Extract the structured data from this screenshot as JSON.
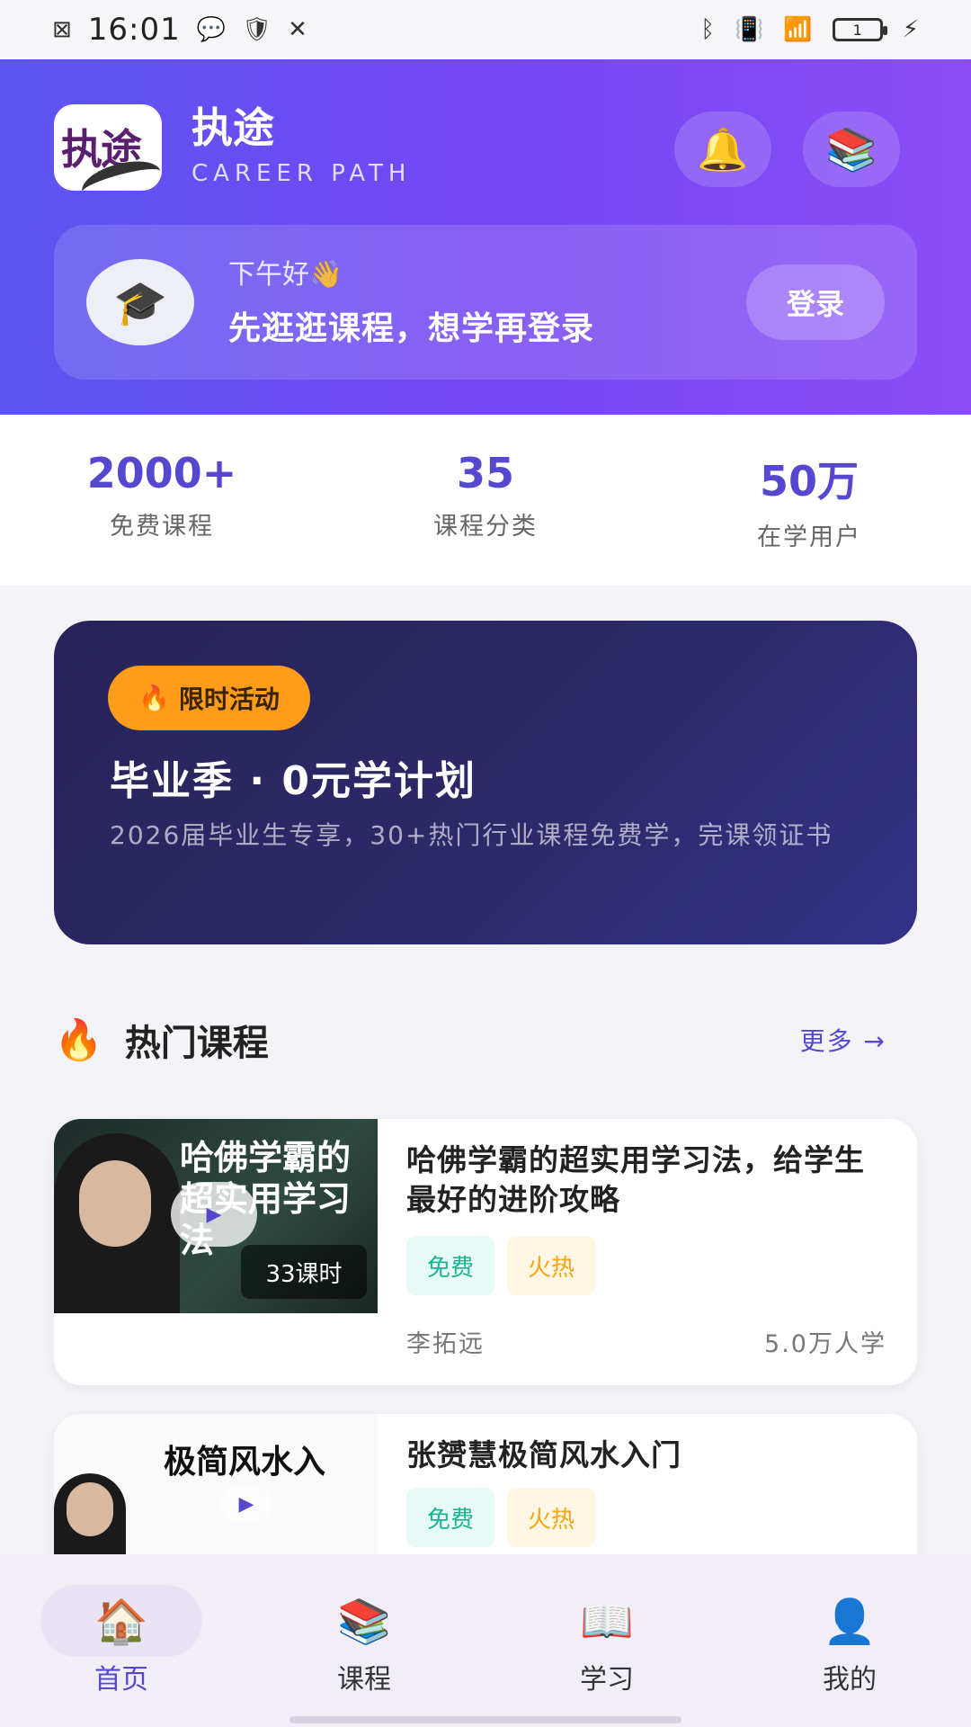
{
  "status_bar": {
    "time": "16:01",
    "battery": "1"
  },
  "header": {
    "logo_text": "执途",
    "app_name": "执途",
    "app_subtitle": "CAREER PATH",
    "bell_icon": "🔔",
    "books_icon": "📚"
  },
  "greeting": {
    "small": "下午好👋",
    "big": "先逛逛课程，想学再登录",
    "login_label": "登录",
    "avatar_icon": "🎓"
  },
  "stats": [
    {
      "value": "2000+",
      "label": "免费课程"
    },
    {
      "value": "35",
      "label": "课程分类"
    },
    {
      "value": "50万",
      "label": "在学用户"
    }
  ],
  "promo": {
    "badge": "限时活动",
    "title": "毕业季 · 0元学计划",
    "desc": "2026届毕业生专享，30+热门行业课程免费学，完课领证书"
  },
  "section": {
    "title": "热门课程",
    "more": "更多 →"
  },
  "courses": [
    {
      "thumb_text": "哈佛学霸的\n超实用学习法",
      "lessons": "33课时",
      "title": "哈佛学霸的超实用学习法，给学生最好的进阶攻略",
      "tags": [
        "免费",
        "火热"
      ],
      "teacher": "李拓远",
      "learners": "5.0万人学"
    },
    {
      "thumb_text": "极简风水入",
      "title": "张赟慧极简风水入门",
      "tags": [
        "免费",
        "火热"
      ]
    }
  ],
  "nav": [
    {
      "label": "首页",
      "icon": "🏠"
    },
    {
      "label": "课程",
      "icon": "📚"
    },
    {
      "label": "学习",
      "icon": "📖"
    },
    {
      "label": "我的",
      "icon": "👤"
    }
  ],
  "colors": {
    "primary": "#5548cf",
    "header_gradient_start": "#5b55f0",
    "header_gradient_end": "#8b4ef6",
    "promo_bg": "#28235a",
    "badge_orange": "#ff9c1a"
  }
}
